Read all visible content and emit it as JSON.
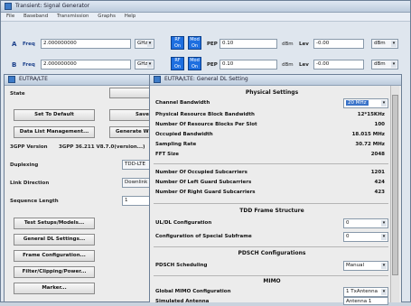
{
  "main_window": {
    "title": "Transient: Signal Generator",
    "menu": [
      "File",
      "Baseband",
      "Transmission",
      "Graphs",
      "Help"
    ],
    "rows": [
      {
        "label": "A",
        "freq_label": "Freq",
        "freq_value": "2.000000000",
        "freq_unit": "GHz",
        "rf_on": "RF On",
        "mod_on": "Mod On",
        "pep_label": "PEP",
        "pep_value": "0.10",
        "pep_unit": "dBm",
        "lev_label": "Lev",
        "lev_value": "-0.00",
        "lev_unit": "dBm"
      },
      {
        "label": "B",
        "freq_label": "Freq",
        "freq_value": "2.000000000",
        "freq_unit": "GHz",
        "rf_on": "RF On",
        "mod_on": "Mod On",
        "pep_label": "PEP",
        "pep_value": "0.10",
        "pep_unit": "dBm",
        "lev_label": "Lev",
        "lev_value": "-0.00",
        "lev_unit": "dBm"
      }
    ]
  },
  "eutra_window": {
    "title": "EUTRA/LTE",
    "state_label": "State",
    "buttons": {
      "set_default": "Set To Default",
      "save": "Save",
      "data_list": "Data List Management...",
      "generate": "Generate W"
    },
    "version_label": "3GPP Version",
    "version_value": "3GPP 36.211 V8.7.0(version...)",
    "duplexing_label": "Duplexing",
    "duplexing_value": "TDD-LTE",
    "link_label": "Link Direction",
    "link_value": "Downlink",
    "seq_label": "Sequence Length",
    "seq_value": "1",
    "side_buttons": [
      "Test Setups/Models...",
      "General DL Settings...",
      "Frame Configuration...",
      "Filter/Clipping/Power...",
      "Marker..."
    ]
  },
  "dl_window": {
    "title": "EUTRA/LTE: General DL Setting",
    "physical_header": "Physical Settings",
    "channel_bw_label": "Channel Bandwidth",
    "channel_bw_value": "20 MHz",
    "rows": [
      {
        "label": "Physical Resource Block Bandwidth",
        "value": "12*15KHz"
      },
      {
        "label": "Number Of Resource Blocks Per Slot",
        "value": "100"
      },
      {
        "label": "Occupied Bandwidth",
        "value": "18.015 MHz"
      },
      {
        "label": "Sampling Rate",
        "value": "30.72 MHz"
      },
      {
        "label": "FFT Size",
        "value": "2048"
      }
    ],
    "subcarrier_rows": [
      {
        "label": "Number Of Occupied Subcarriers",
        "value": "1201"
      },
      {
        "label": "Number Of Left Guard Subcarriers",
        "value": "424"
      },
      {
        "label": "Number Of Right Guard Subcarriers",
        "value": "423"
      }
    ],
    "tdd_header": "TDD Frame Structure",
    "uldl_label": "UL/DL Configuration",
    "uldl_value": "0",
    "special_label": "Configuration of Special Subframe",
    "special_value": "0",
    "pdsch_header": "PDSCH Configurations",
    "pdsch_label": "PDSCH Scheduling",
    "pdsch_value": "Manual",
    "mimo_header": "MIMO",
    "mimo_label": "Global MIMO Configuration",
    "mimo_value": "1 TxAntenna",
    "sim_label": "Simulated Antenna",
    "sim_value": "Antenna 1"
  }
}
